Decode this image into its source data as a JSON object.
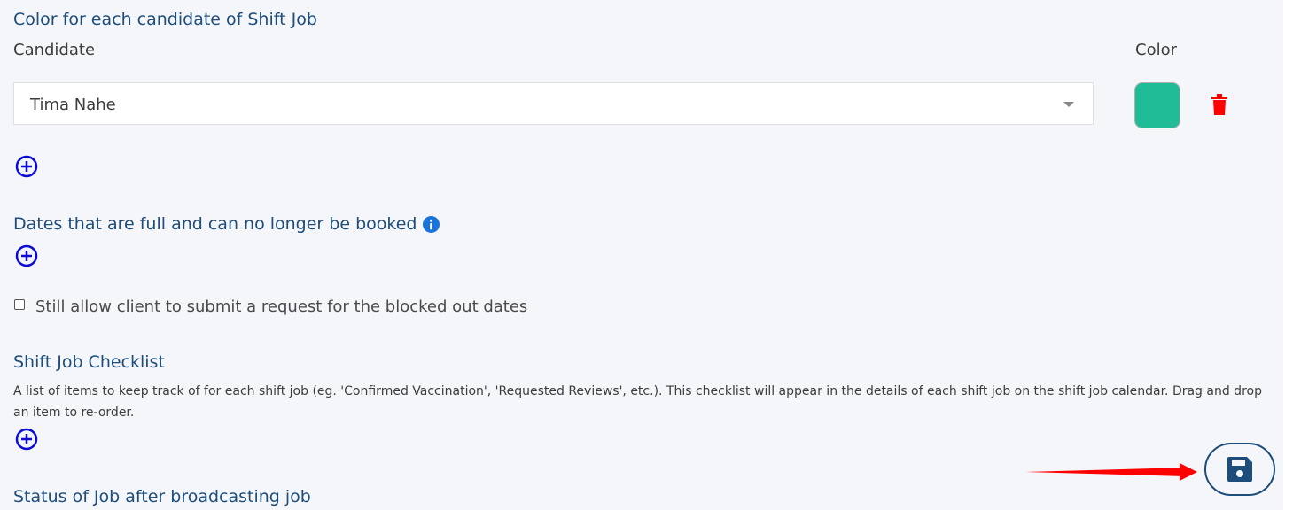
{
  "candidate_colors": {
    "title": "Color for each candidate of Shift Job",
    "candidate_header": "Candidate",
    "color_header": "Color",
    "rows": [
      {
        "candidate": "Tima Nahe",
        "color": "#20bc98"
      }
    ]
  },
  "full_dates": {
    "title": "Dates that are full and can no longer be booked",
    "checkbox_label": "Still allow client to submit a request for the blocked out dates",
    "checkbox_checked": false
  },
  "checklist": {
    "title": "Shift Job Checklist",
    "description": "A list of items to keep track of for each shift job (eg. 'Confirmed Vaccination', 'Requested Reviews', etc.). This checklist will appear in the details of each shift job on the shift job calendar. Drag and drop an item to re-order."
  },
  "status_after_broadcast": {
    "title": "Status of Job after broadcasting job"
  },
  "colors": {
    "heading": "#1d4d7a",
    "add_icon": "#0b0bd6",
    "delete_icon": "#ff0000",
    "info_icon": "#1a73d9",
    "arrow": "#ff0000"
  },
  "icons": {
    "add": "plus-circle-icon",
    "delete": "trash-icon",
    "info": "info-icon",
    "save": "floppy-disk-icon",
    "dropdown": "caret-down-icon"
  }
}
